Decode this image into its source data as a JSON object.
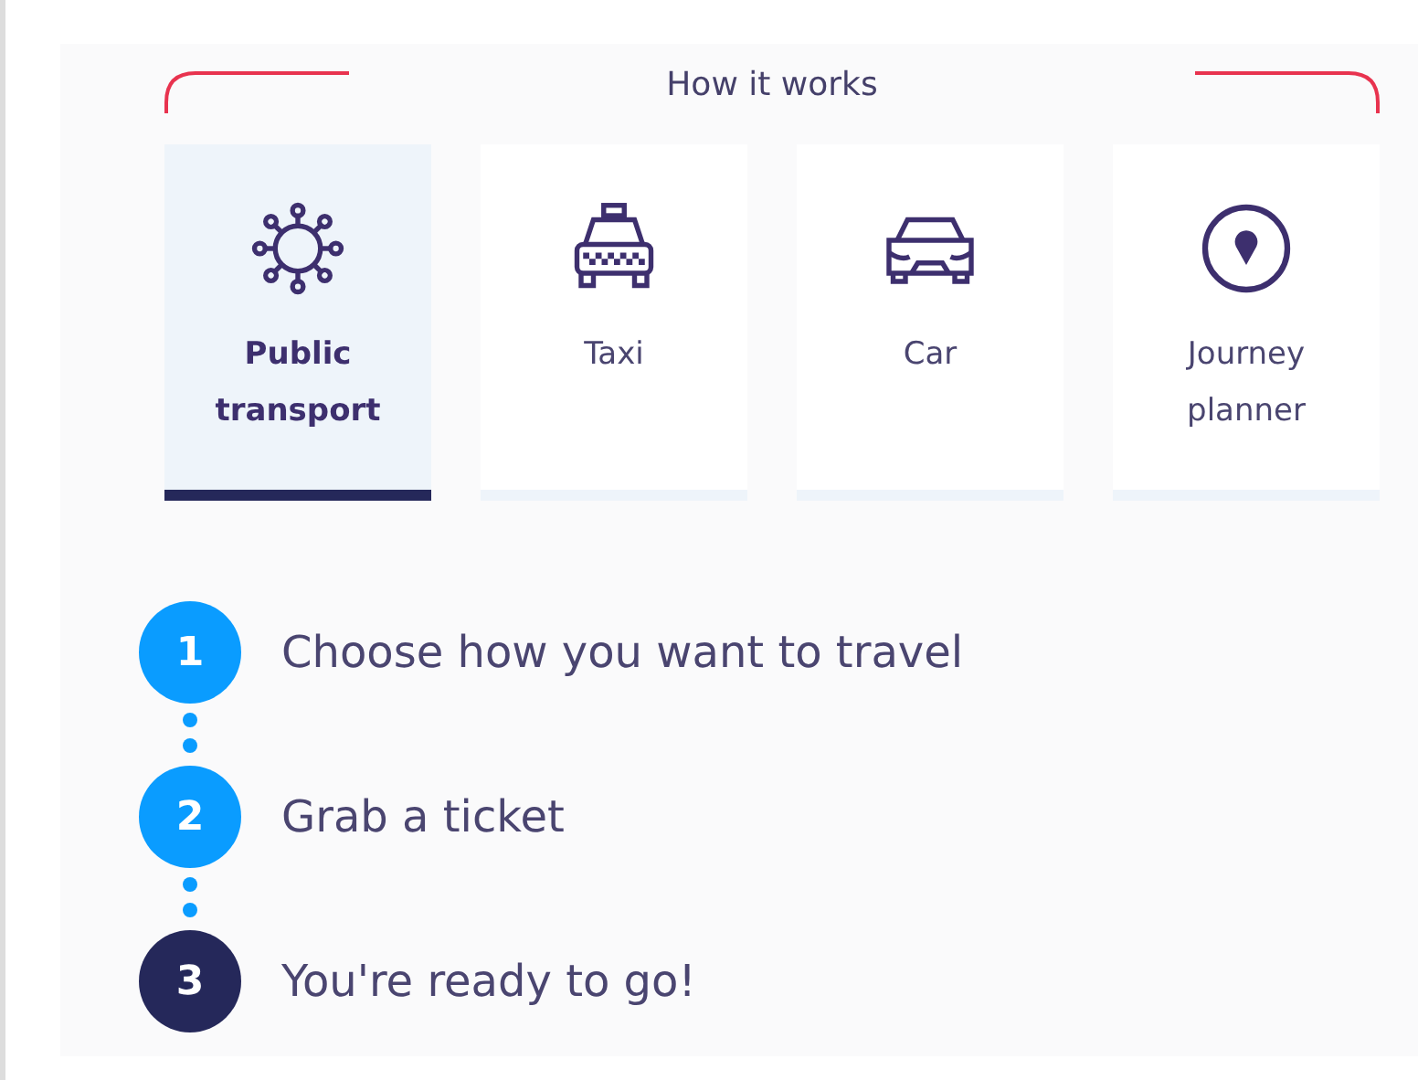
{
  "heading": "How it works",
  "tabs": [
    {
      "label": "Public transport",
      "kind": "transport",
      "selected": true
    },
    {
      "label": "Taxi",
      "kind": "taxi",
      "selected": false
    },
    {
      "label": "Car",
      "kind": "car",
      "selected": false
    },
    {
      "label": "Journey planner",
      "kind": "pin",
      "selected": false
    }
  ],
  "steps": [
    {
      "number": "1",
      "text": "Choose how you want to travel",
      "color": "#0a9cff"
    },
    {
      "number": "2",
      "text": "Grab a ticket",
      "color": "#0a9cff"
    },
    {
      "number": "3",
      "text": "You're ready to go!",
      "color": "#25285a"
    }
  ]
}
